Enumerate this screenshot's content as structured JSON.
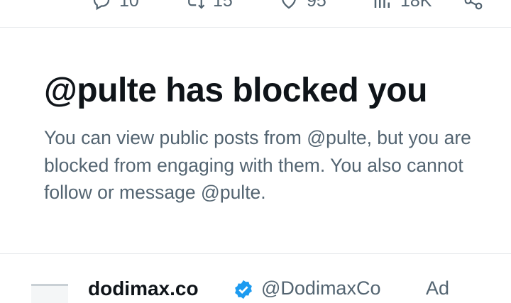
{
  "actions": {
    "replies": {
      "icon": "reply-icon",
      "count": "10"
    },
    "reposts": {
      "icon": "repost-icon",
      "count": "15"
    },
    "likes": {
      "icon": "like-icon",
      "count": "95"
    },
    "views": {
      "icon": "views-icon",
      "count": "18K"
    },
    "share": {
      "icon": "share-icon"
    }
  },
  "blocked_notice": {
    "title": "@pulte has blocked you",
    "message": "You can view public posts from @pulte, but you are blocked from engaging with them. You also cannot follow or message @pulte."
  },
  "next_post": {
    "avatar_icon": "avatar-image",
    "name": "dodimax.co",
    "verified_icon": "verified-badge-icon",
    "handle": "@DodimaxCo",
    "ad_label": "Ad"
  },
  "colors": {
    "text_primary": "#0f1419",
    "text_secondary": "#536471",
    "divider": "#e7eaec",
    "verified": "#1d9bf0"
  }
}
